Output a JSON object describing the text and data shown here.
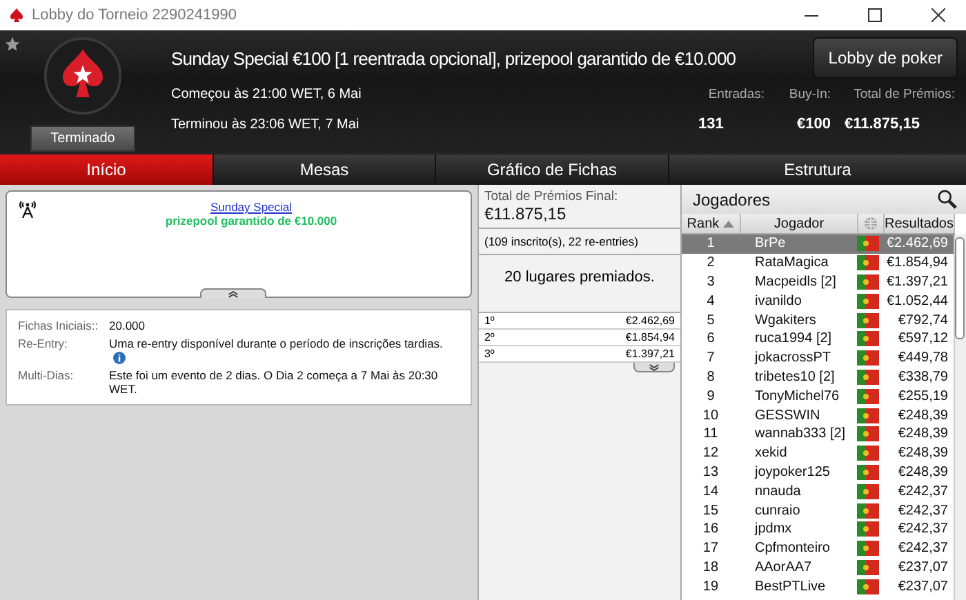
{
  "window": {
    "title": "Lobby do Torneio 2290241990"
  },
  "header": {
    "status": "Terminado",
    "title": "Sunday Special €100 [1 reentrada opcional], prizepool garantido de €10.000",
    "lobby_button": "Lobby de poker",
    "started": "Começou às 21:00 WET, 6 Mai",
    "ended": "Terminou às 23:06 WET, 7 Mai",
    "stats": [
      {
        "label": "Entradas:",
        "value": "131"
      },
      {
        "label": "Buy-In:",
        "value": "€100"
      },
      {
        "label": "Total de Prémios:",
        "value": "€11.875,15"
      }
    ]
  },
  "tabs": [
    {
      "label": "Início",
      "selected": true
    },
    {
      "label": "Mesas",
      "selected": false
    },
    {
      "label": "Gráfico de Fichas",
      "selected": false
    },
    {
      "label": "Estrutura",
      "selected": false
    }
  ],
  "news": {
    "link": "Sunday Special",
    "text": "prizepool garantido de €10.000"
  },
  "info": [
    {
      "label": "Fichas Iniciais::",
      "value": "20.000",
      "has_info": false
    },
    {
      "label": "Re-Entry:",
      "value": "Uma re-entry disponível durante o período de inscrições tardias.",
      "has_info": true
    },
    {
      "label": "Multi-Dias:",
      "value": "Este foi um evento de 2 dias. O Dia 2 começa a 7 Mai às 20:30 WET.",
      "has_info": false
    }
  ],
  "prizes": {
    "total_label": "Total de Prémios Final:",
    "total": "€11.875,15",
    "entries": "(109 inscrito(s), 22 re-entries)",
    "places": "20 lugares premiados.",
    "rows": [
      {
        "place": "1º",
        "amount": "€2.462,69"
      },
      {
        "place": "2º",
        "amount": "€1.854,94"
      },
      {
        "place": "3º",
        "amount": "€1.397,21"
      }
    ]
  },
  "players": {
    "title": "Jogadores",
    "columns": [
      "Rank",
      "Jogador",
      "Resultados"
    ],
    "rows": [
      {
        "rank": "1",
        "name": "BrPe",
        "result": "€2.462,69",
        "selected": true
      },
      {
        "rank": "2",
        "name": "RataMagica",
        "result": "€1.854,94",
        "selected": false
      },
      {
        "rank": "3",
        "name": "Macpeidls [2]",
        "result": "€1.397,21",
        "selected": false
      },
      {
        "rank": "4",
        "name": "ivanildo",
        "result": "€1.052,44",
        "selected": false
      },
      {
        "rank": "5",
        "name": "Wgakiters",
        "result": "€792,74",
        "selected": false
      },
      {
        "rank": "6",
        "name": "ruca1994 [2]",
        "result": "€597,12",
        "selected": false
      },
      {
        "rank": "7",
        "name": "jokacrossPT",
        "result": "€449,78",
        "selected": false
      },
      {
        "rank": "8",
        "name": "tribetes10 [2]",
        "result": "€338,79",
        "selected": false
      },
      {
        "rank": "9",
        "name": "TonyMichel76",
        "result": "€255,19",
        "selected": false
      },
      {
        "rank": "10",
        "name": "GESSWIN",
        "result": "€248,39",
        "selected": false
      },
      {
        "rank": "11",
        "name": "wannab333 [2]",
        "result": "€248,39",
        "selected": false
      },
      {
        "rank": "12",
        "name": "xekid",
        "result": "€248,39",
        "selected": false
      },
      {
        "rank": "13",
        "name": "joypoker125",
        "result": "€248,39",
        "selected": false
      },
      {
        "rank": "14",
        "name": "nnauda",
        "result": "€242,37",
        "selected": false
      },
      {
        "rank": "15",
        "name": "cunraio",
        "result": "€242,37",
        "selected": false
      },
      {
        "rank": "16",
        "name": "jpdmx",
        "result": "€242,37",
        "selected": false
      },
      {
        "rank": "17",
        "name": "Cpfmonteiro",
        "result": "€242,37",
        "selected": false
      },
      {
        "rank": "18",
        "name": "AAorAA7",
        "result": "€237,07",
        "selected": false
      },
      {
        "rank": "19",
        "name": "BestPTLive",
        "result": "€237,07",
        "selected": false
      }
    ]
  }
}
